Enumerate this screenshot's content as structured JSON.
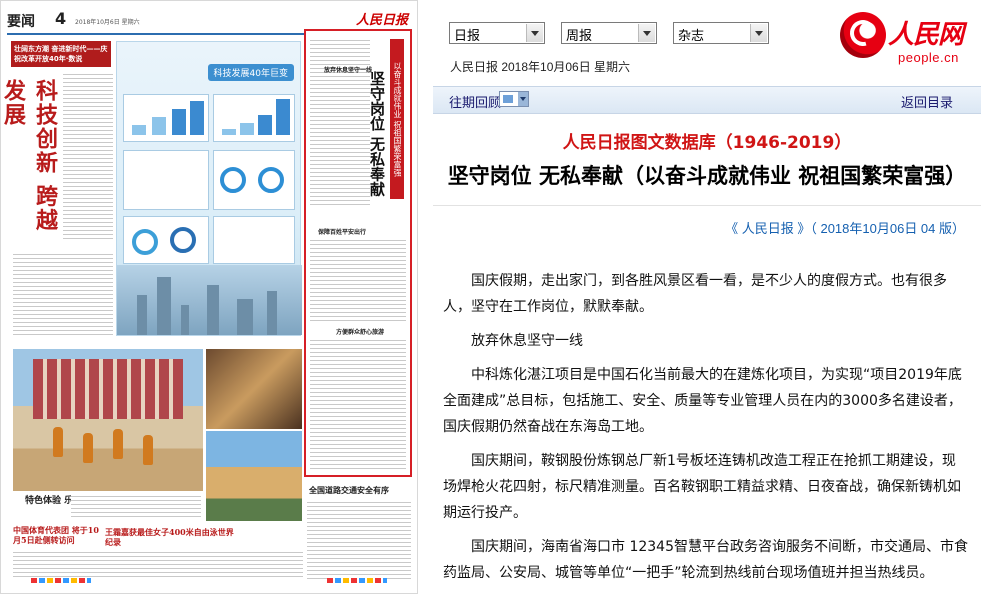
{
  "paper": {
    "section": "要闻",
    "page": "4",
    "date_line": "2018年10月6日 星期六",
    "logo": "人民日报",
    "banner_left": "壮阔东方潮 奋进新时代——庆祝改革开放40年·数说",
    "left_vertical_title": "科技创新 跨越发展",
    "infographic_title": "科技发展40年巨变",
    "right_vertical_tag": "以奋斗成就伟业 祝祖国繁荣富强",
    "right_vertical_title": "坚守岗位 无私奉献",
    "sub_head_1": "放弃休息坚守一线",
    "sub_head_2": "保障百姓平安出行",
    "sub_head_3": "方便群众舒心旅游",
    "photo1_caption": "特色体验 乐享假期",
    "bottom_head_1": "全国道路交通安全有序",
    "bottom_head_2": "中国体育代表团 将于10月5日赴侧转访问",
    "bottom_head_3": "王霜嘉获最佳女子400米自由泳世界纪录"
  },
  "controls": {
    "select_daily": "日报",
    "select_weekly": "周报",
    "select_magazine": "杂志",
    "dateline": "人民日报 2018年10月06日 星期六",
    "back_issue": "往期回顾",
    "return_toc": "返回目录"
  },
  "brand": {
    "logo_text": "人民网",
    "logo_url": "people.cn"
  },
  "article": {
    "database_title": "人民日报图文数据库（1946-2019）",
    "title": "坚守岗位 无私奉献（以奋斗成就伟业 祝祖国繁荣富强）",
    "source": "《 人民日报 》（ 2018年10月06日   04 版）",
    "paragraphs": [
      "国庆假期，走出家门，到各胜风景区看一看，是不少人的度假方式。也有很多人，坚守在工作岗位，默默奉献。",
      "放弃休息坚守一线",
      "中科炼化湛江项目是中国石化当前最大的在建炼化项目，为实现“项目2019年底全面建成”总目标，包括施工、安全、质量等专业管理人员在内的3000多名建设者，国庆假期仍然奋战在东海岛工地。",
      "国庆期间，鞍钢股份炼钢总厂新1号板坯连铸机改造工程正在抢抓工期建设，现场焊枪火花四射，标尺精准测量。百名鞍钢职工精益求精、日夜奋战，确保新铸机如期运行投产。",
      "国庆期间，海南省海口市 12345智慧平台政务咨询服务不间断，市交通局、市食药监局、公安局、城管等单位“一把手”轮流到热线前台现场值班并担当热线员。"
    ]
  },
  "colors": {
    "brand_red": "#e60012",
    "title_red": "#d01515",
    "link_blue": "#1560b0",
    "highlight_border": "#d61f26"
  }
}
